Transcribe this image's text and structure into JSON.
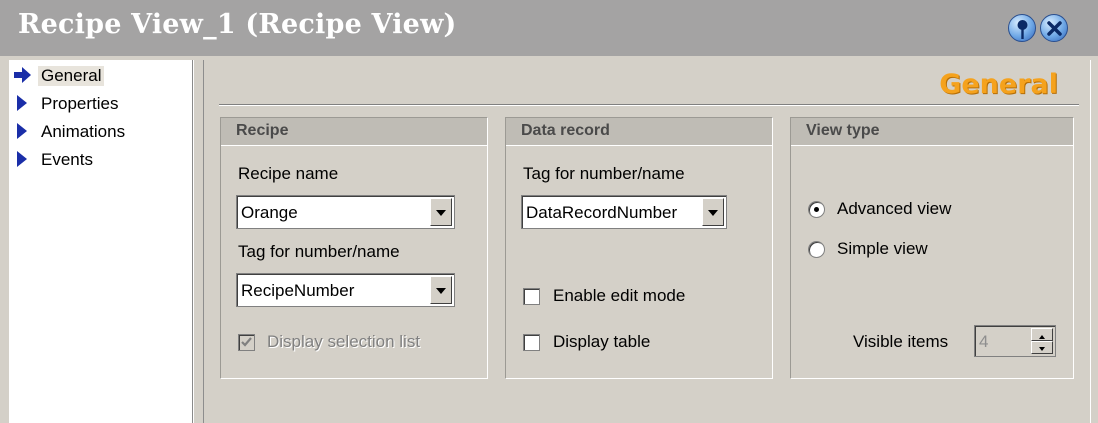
{
  "window": {
    "title": "Recipe View_1 (Recipe View)"
  },
  "titlebar_buttons": {
    "pin_icon": "pin-icon",
    "close_icon": "close-icon"
  },
  "sidebar": {
    "items": [
      {
        "label": "General",
        "selected": true
      },
      {
        "label": "Properties",
        "selected": false
      },
      {
        "label": "Animations",
        "selected": false
      },
      {
        "label": "Events",
        "selected": false
      }
    ]
  },
  "main": {
    "heading": "General",
    "recipe_group": {
      "title": "Recipe",
      "recipe_name_label": "Recipe name",
      "recipe_name_value": "Orange",
      "tag_label": "Tag for number/name",
      "tag_value": "RecipeNumber",
      "display_selection_list_label": "Display selection list",
      "display_selection_list_checked": true
    },
    "data_record_group": {
      "title": "Data record",
      "tag_label": "Tag for number/name",
      "tag_value": "DataRecordNumber",
      "enable_edit_mode_label": "Enable edit mode",
      "enable_edit_mode_checked": false,
      "display_table_label": "Display table",
      "display_table_checked": false
    },
    "view_type_group": {
      "title": "View type",
      "advanced_view_label": "Advanced view",
      "simple_view_label": "Simple view",
      "selected": "Advanced view",
      "visible_items_label": "Visible items",
      "visible_items_value": "4"
    }
  },
  "colors": {
    "heading": "#f5a21d",
    "nav_arrow": "#1a2ea8",
    "titlebar": "#a4a3a3",
    "panel": "#d4d0c8"
  }
}
